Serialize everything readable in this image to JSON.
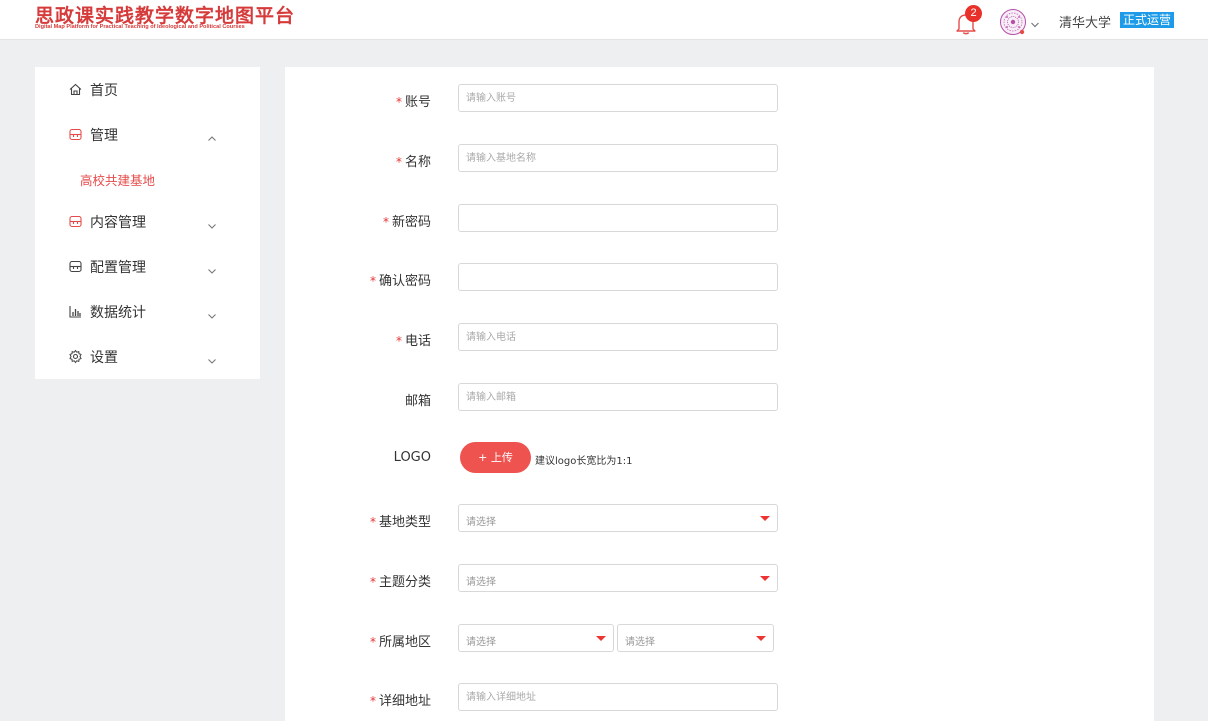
{
  "header": {
    "title": "思政课实践教学数字地图平台",
    "subtitle": "Digital Map Platform for Practical Teaching of Ideological and Political Courses",
    "notification_count": "2",
    "school": "清华大学",
    "status": "正式运营"
  },
  "sidebar": {
    "items": [
      {
        "label": "首页",
        "icon": "home-icon"
      },
      {
        "label": "管理",
        "icon": "box-icon",
        "expanded": true
      },
      {
        "label": "内容管理",
        "icon": "box-icon"
      },
      {
        "label": "配置管理",
        "icon": "box-icon"
      },
      {
        "label": "数据统计",
        "icon": "chart-icon"
      },
      {
        "label": "设置",
        "icon": "gear-icon"
      }
    ],
    "sub_item": "高校共建基地"
  },
  "form": {
    "account": {
      "label": "账号",
      "required": true,
      "placeholder": "请输入账号"
    },
    "name": {
      "label": "名称",
      "required": true,
      "placeholder": "请输入基地名称"
    },
    "new_password": {
      "label": "新密码",
      "required": true,
      "placeholder": ""
    },
    "confirm_password": {
      "label": "确认密码",
      "required": true,
      "placeholder": ""
    },
    "phone": {
      "label": "电话",
      "required": true,
      "placeholder": "请输入电话"
    },
    "email": {
      "label": "邮箱",
      "required": false,
      "placeholder": "请输入邮箱"
    },
    "logo": {
      "label": "LOGO",
      "button": "+ 上传",
      "hint": "建议logo长宽比为1:1"
    },
    "base_type": {
      "label": "基地类型",
      "required": true,
      "placeholder": "请选择"
    },
    "theme": {
      "label": "主题分类",
      "required": true,
      "placeholder": "请选择"
    },
    "region": {
      "label": "所属地区",
      "required": true,
      "placeholder1": "请选择",
      "placeholder2": "请选择"
    },
    "address": {
      "label": "详细地址",
      "required": true,
      "placeholder": "请输入详细地址"
    }
  },
  "colors": {
    "brand": "#d63b3b",
    "accent": "#ef5350",
    "status_bg": "#1e9be8",
    "required": "#e63434"
  }
}
